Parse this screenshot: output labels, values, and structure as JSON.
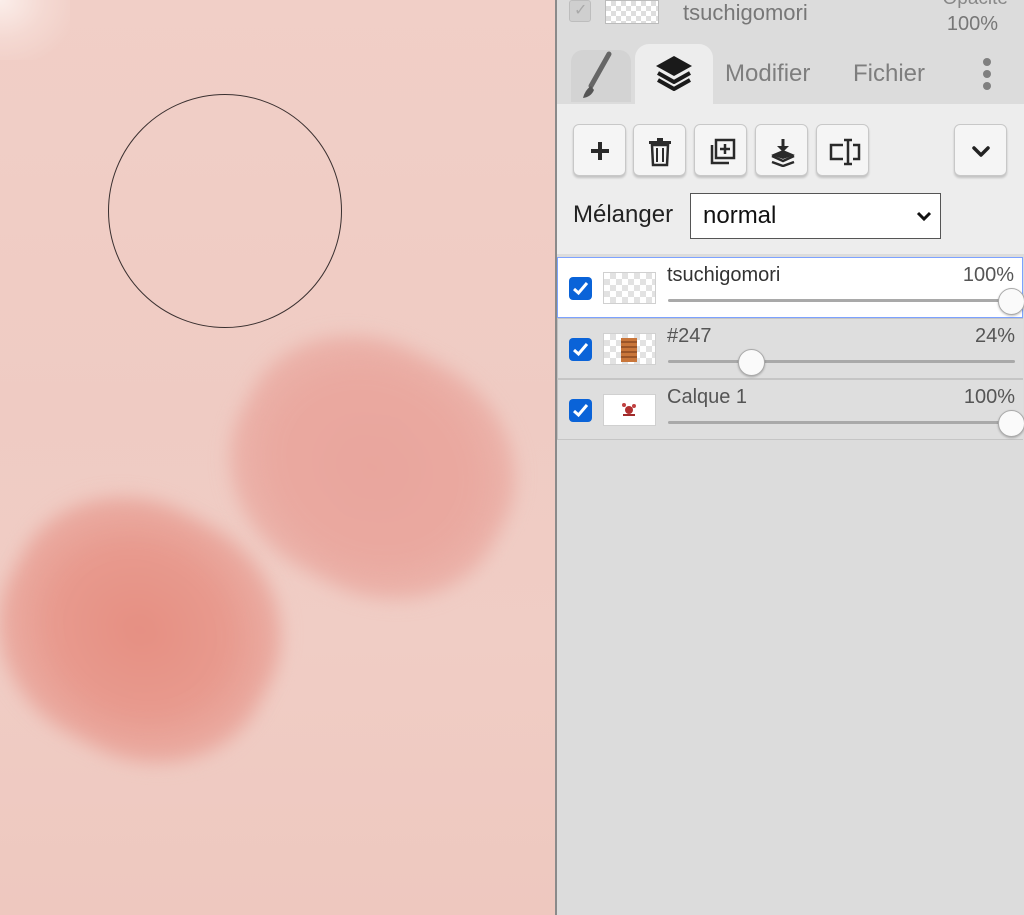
{
  "header": {
    "layer_name": "tsuchigomori",
    "opacity_label": "Opacité",
    "opacity_value": "100%"
  },
  "tabs": [
    {
      "icon": "brush-icon",
      "active": false
    },
    {
      "icon": "layers-icon",
      "active": true
    },
    {
      "label": "Modifier"
    },
    {
      "label": "Fichier"
    }
  ],
  "toolbar": {
    "buttons": [
      "add-layer-icon",
      "trash-icon",
      "duplicate-icon",
      "merge-down-icon",
      "rename-icon",
      "chevron-down-icon"
    ]
  },
  "blend": {
    "label": "Mélanger",
    "value": "normal"
  },
  "layers": [
    {
      "name": "tsuchigomori",
      "opacity": "100%",
      "opacity_fraction": 1.0,
      "visible": true,
      "selected": true
    },
    {
      "name": "#247",
      "opacity": "24%",
      "opacity_fraction": 0.24,
      "visible": true,
      "selected": false
    },
    {
      "name": "Calque 1",
      "opacity": "100%",
      "opacity_fraction": 1.0,
      "visible": true,
      "selected": false
    }
  ],
  "colors": {
    "accent": "#0a63d8",
    "canvas": "#f0cdc5",
    "stroke": "#e89a8e"
  }
}
